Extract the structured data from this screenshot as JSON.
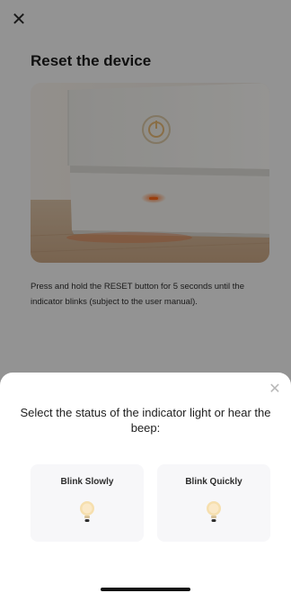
{
  "header": {
    "close_icon": "close-icon",
    "title": "Reset the device"
  },
  "hero": {
    "image_icon": "device-reset-photo"
  },
  "instruction": "Press and hold the RESET button for 5 seconds until the indicator blinks (subject to the user manual).",
  "sheet": {
    "close_icon": "close-icon",
    "prompt": "Select the status of the indicator light or hear the beep:",
    "options": [
      {
        "label": "Blink Slowly",
        "icon": "bulb-icon"
      },
      {
        "label": "Blink Quickly",
        "icon": "bulb-icon"
      }
    ]
  },
  "colors": {
    "overlay": "#000000",
    "sheet_bg": "#ffffff",
    "option_bg": "#f7f7f9",
    "bulb_glow": "#f6dfae"
  }
}
